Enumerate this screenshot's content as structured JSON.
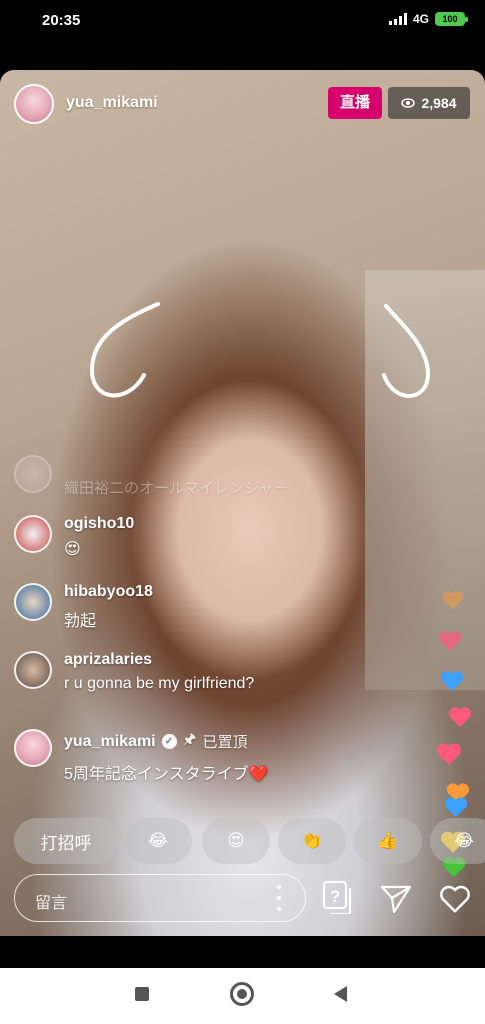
{
  "status_bar": {
    "time": "20:35",
    "network": "4G",
    "battery": "100"
  },
  "live": {
    "host_username": "yua_mikami",
    "live_label": "直播",
    "viewer_count": "2,984",
    "overlay_text": "織田裕二のオールマイレンジャー"
  },
  "comments": [
    {
      "username": "",
      "text": "",
      "faded": true
    },
    {
      "username": "ogisho10",
      "text": "😍"
    },
    {
      "username": "hibabyoo18",
      "text": "勃起"
    },
    {
      "username": "aprizalaries",
      "text": "r u gonna be my girlfriend?"
    },
    {
      "username": "yua_mikami",
      "text": "5周年記念インスタライブ❤️",
      "verified": true,
      "pinned_label": "已置頂"
    }
  ],
  "quick_reactions": [
    "打招呼",
    "😂",
    "😍",
    "👏",
    "👍",
    "😂"
  ],
  "comment_bar": {
    "placeholder": "留言"
  },
  "colors": {
    "live_badge": "#d6006d",
    "battery": "#4fc94f",
    "hearts": [
      "#ff5a7a",
      "#ff9a3c",
      "#3ea0ff",
      "#ffd23c",
      "#45c43a"
    ]
  },
  "icons": {
    "question_box": "question-box-icon",
    "send": "send-icon",
    "like": "heart-outline-icon",
    "verified": "verified-check-icon",
    "pin": "pin-icon",
    "eye": "eye-icon"
  }
}
